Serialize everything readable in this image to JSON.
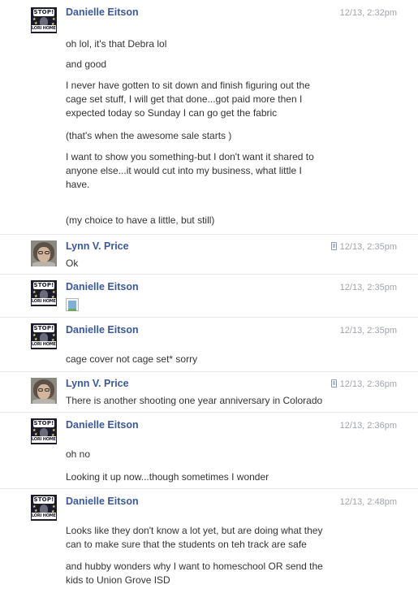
{
  "messages": [
    {
      "author": "Danielle Eitson",
      "avatar": "stop-poster-avatar",
      "time": "12/13, 2:32pm",
      "mobile": false,
      "lines": [
        "oh lol, it's that Debra lol",
        "and good",
        "I never have gotten to sit down and finish figuring out the",
        "cage set stuff, I will get that done...got paid more then I",
        "expected today so Sunday I can go get the fabric",
        "(that's when the awesome sale starts      )",
        "I want to show you something-but I don't want it shared to",
        "anyone else...it would cut into my business, what little I",
        "have.",
        "(my choice to have a little, but still)"
      ]
    },
    {
      "author": "Lynn V. Price",
      "avatar": "user-photo-avatar",
      "time": "12/13, 2:35pm",
      "mobile": true,
      "lines": [
        "Ok"
      ]
    },
    {
      "author": "Danielle Eitson",
      "avatar": "stop-poster-avatar",
      "time": "12/13, 2:35pm",
      "mobile": false,
      "lines": [],
      "attachment": "broken-image-icon"
    },
    {
      "author": "Danielle Eitson",
      "avatar": "stop-poster-avatar",
      "time": "12/13, 2:35pm",
      "mobile": false,
      "lines": [
        "cage cover not cage set* sorry"
      ]
    },
    {
      "author": "Lynn V. Price",
      "avatar": "user-photo-avatar",
      "time": "12/13, 2:36pm",
      "mobile": true,
      "lines": [
        "There is another shooting one year anniversary in Colorado"
      ]
    },
    {
      "author": "Danielle Eitson",
      "avatar": "stop-poster-avatar",
      "time": "12/13, 2:36pm",
      "mobile": false,
      "lines": [
        "oh no",
        "Looking it up now...though sometimes I wonder"
      ]
    },
    {
      "author": "Danielle Eitson",
      "avatar": "stop-poster-avatar",
      "time": "12/13, 2:48pm",
      "mobile": false,
      "lines": [
        "Looks like they don't know a lot yet, but are doing what they",
        "can to make sure that the students on teh track are safe",
        "and hubby wonders why I want to homeschool OR send the",
        "kids to Union Grove ISD"
      ]
    }
  ],
  "avatar_text": {
    "stop_top": "STOP!",
    "stop_bottom": "LORI HOMER"
  },
  "colors": {
    "author_link": "#3b5998",
    "timestamp": "#a0a4ab",
    "message_text": "#333333",
    "divider": "#e9eaed"
  }
}
